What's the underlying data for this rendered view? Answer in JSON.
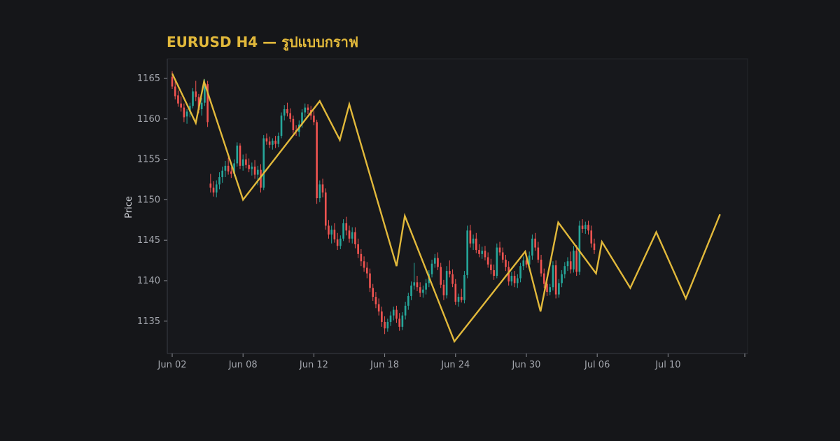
{
  "chart_data": {
    "type": "candlestick",
    "title": "EURUSD H4 — รูปแบบกราฟ",
    "ylabel": "Price",
    "ylim": [
      1131,
      1167
    ],
    "y_ticks": [
      1135,
      1140,
      1145,
      1150,
      1155,
      1160,
      1165
    ],
    "x_ticks": [
      "Jun 02",
      "Jun 08",
      "Jun 12",
      "Jun 18",
      "Jun 24",
      "Jun 30",
      "Jul 06",
      "Jul 10"
    ],
    "xlim": [
      0,
      48.5
    ],
    "x_tick_positions": [
      0,
      6,
      12,
      18,
      24,
      30,
      36,
      42
    ],
    "colors": {
      "background": "#151619",
      "plot_background": "#17181c",
      "up": "#26a69a",
      "down": "#ef5350",
      "zigzag": "#e2b93b",
      "axis": "#3a3d45",
      "text": "#a3a6ad"
    },
    "candle_step": 0.25,
    "candles": [
      [
        1165.2,
        1165.9,
        1163.7,
        1164.0
      ],
      [
        1164.0,
        1164.8,
        1162.4,
        1162.8
      ],
      [
        1162.9,
        1163.5,
        1161.5,
        1161.9
      ],
      [
        1161.9,
        1162.8,
        1160.9,
        1161.4
      ],
      [
        1161.4,
        1161.9,
        1159.6,
        1160.2
      ],
      [
        1160.3,
        1161.2,
        1159.4,
        1160.9
      ],
      [
        1160.9,
        1162.0,
        1160.2,
        1161.6
      ],
      [
        1161.6,
        1163.8,
        1161.3,
        1163.4
      ],
      [
        1163.4,
        1164.7,
        1162.2,
        1162.7
      ],
      [
        1162.7,
        1163.1,
        1160.7,
        1161.1
      ],
      [
        1161.2,
        1162.6,
        1160.4,
        1162.0
      ],
      [
        1162.0,
        1164.9,
        1161.6,
        1164.3
      ],
      [
        1164.3,
        1164.7,
        1159.0,
        1159.6
      ],
      [
        1152.0,
        1153.2,
        1150.9,
        1151.5
      ],
      [
        1151.5,
        1152.3,
        1150.4,
        1150.9
      ],
      [
        1150.9,
        1152.4,
        1150.3,
        1151.9
      ],
      [
        1151.9,
        1153.4,
        1151.3,
        1152.8
      ],
      [
        1152.8,
        1154.1,
        1152.1,
        1153.6
      ],
      [
        1153.6,
        1154.8,
        1152.8,
        1154.2
      ],
      [
        1154.2,
        1155.2,
        1153.1,
        1153.5
      ],
      [
        1153.5,
        1154.0,
        1152.7,
        1153.2
      ],
      [
        1153.2,
        1155.0,
        1152.9,
        1154.5
      ],
      [
        1154.5,
        1157.1,
        1154.1,
        1156.7
      ],
      [
        1156.7,
        1157.0,
        1153.8,
        1154.2
      ],
      [
        1154.2,
        1155.6,
        1153.6,
        1155.0
      ],
      [
        1155.0,
        1155.7,
        1153.9,
        1154.3
      ],
      [
        1154.3,
        1155.1,
        1153.4,
        1153.8
      ],
      [
        1153.8,
        1154.6,
        1153.0,
        1154.1
      ],
      [
        1154.1,
        1154.9,
        1152.6,
        1153.1
      ],
      [
        1153.1,
        1154.2,
        1151.8,
        1153.7
      ],
      [
        1153.7,
        1154.4,
        1150.9,
        1151.5
      ],
      [
        1151.5,
        1158.0,
        1151.2,
        1157.6
      ],
      [
        1157.6,
        1158.2,
        1156.8,
        1157.2
      ],
      [
        1157.2,
        1157.8,
        1156.4,
        1156.8
      ],
      [
        1156.8,
        1157.6,
        1156.2,
        1157.3
      ],
      [
        1157.3,
        1157.9,
        1156.4,
        1156.9
      ],
      [
        1156.9,
        1158.3,
        1156.5,
        1157.9
      ],
      [
        1157.9,
        1160.8,
        1157.6,
        1160.4
      ],
      [
        1160.4,
        1161.7,
        1159.8,
        1161.2
      ],
      [
        1161.2,
        1162.0,
        1160.3,
        1160.7
      ],
      [
        1160.7,
        1161.3,
        1159.6,
        1160.0
      ],
      [
        1160.0,
        1160.4,
        1158.2,
        1158.6
      ],
      [
        1158.6,
        1159.2,
        1157.9,
        1158.4
      ],
      [
        1158.4,
        1159.8,
        1157.8,
        1159.3
      ],
      [
        1159.3,
        1161.2,
        1158.9,
        1160.8
      ],
      [
        1160.8,
        1161.9,
        1160.2,
        1161.4
      ],
      [
        1161.4,
        1161.8,
        1160.6,
        1161.1
      ],
      [
        1161.1,
        1161.6,
        1159.9,
        1160.4
      ],
      [
        1160.4,
        1161.0,
        1159.2,
        1159.6
      ],
      [
        1159.6,
        1159.9,
        1149.5,
        1150.2
      ],
      [
        1150.2,
        1152.4,
        1149.7,
        1151.9
      ],
      [
        1151.9,
        1152.6,
        1150.3,
        1150.9
      ],
      [
        1150.9,
        1151.4,
        1146.3,
        1146.8
      ],
      [
        1146.8,
        1147.5,
        1145.2,
        1145.7
      ],
      [
        1145.7,
        1146.8,
        1144.6,
        1146.3
      ],
      [
        1146.3,
        1147.1,
        1144.7,
        1145.1
      ],
      [
        1145.1,
        1145.9,
        1143.8,
        1144.3
      ],
      [
        1144.3,
        1145.6,
        1143.9,
        1145.2
      ],
      [
        1145.2,
        1147.6,
        1144.9,
        1147.1
      ],
      [
        1147.1,
        1147.9,
        1145.6,
        1146.2
      ],
      [
        1146.2,
        1146.8,
        1144.7,
        1145.2
      ],
      [
        1145.2,
        1146.6,
        1144.6,
        1146.0
      ],
      [
        1146.0,
        1146.6,
        1144.0,
        1144.5
      ],
      [
        1144.5,
        1145.2,
        1142.8,
        1143.3
      ],
      [
        1143.3,
        1143.9,
        1141.8,
        1142.4
      ],
      [
        1142.4,
        1143.0,
        1141.1,
        1141.6
      ],
      [
        1141.6,
        1142.3,
        1140.3,
        1140.9
      ],
      [
        1140.9,
        1141.5,
        1138.6,
        1139.1
      ],
      [
        1139.1,
        1139.6,
        1137.5,
        1138.0
      ],
      [
        1138.0,
        1138.6,
        1136.6,
        1137.1
      ],
      [
        1137.1,
        1137.8,
        1135.7,
        1136.2
      ],
      [
        1136.2,
        1136.8,
        1134.3,
        1134.9
      ],
      [
        1134.9,
        1135.6,
        1133.4,
        1134.1
      ],
      [
        1134.1,
        1135.3,
        1133.7,
        1134.9
      ],
      [
        1134.9,
        1136.2,
        1134.4,
        1135.7
      ],
      [
        1135.7,
        1136.8,
        1135.1,
        1136.4
      ],
      [
        1136.4,
        1136.9,
        1134.8,
        1135.3
      ],
      [
        1135.3,
        1136.0,
        1133.8,
        1134.3
      ],
      [
        1134.3,
        1136.1,
        1133.9,
        1135.7
      ],
      [
        1135.7,
        1137.4,
        1135.2,
        1136.9
      ],
      [
        1136.9,
        1138.5,
        1136.4,
        1138.1
      ],
      [
        1138.1,
        1139.9,
        1137.6,
        1139.4
      ],
      [
        1139.4,
        1142.2,
        1138.9,
        1139.8
      ],
      [
        1139.8,
        1140.6,
        1138.7,
        1139.2
      ],
      [
        1139.2,
        1139.8,
        1138.0,
        1138.5
      ],
      [
        1138.5,
        1139.4,
        1137.9,
        1138.9
      ],
      [
        1138.9,
        1140.2,
        1138.3,
        1139.7
      ],
      [
        1139.7,
        1141.3,
        1139.2,
        1140.8
      ],
      [
        1140.8,
        1142.6,
        1140.4,
        1142.1
      ],
      [
        1142.1,
        1143.3,
        1141.6,
        1142.8
      ],
      [
        1142.8,
        1143.5,
        1141.3,
        1141.7
      ],
      [
        1141.7,
        1142.2,
        1139.1,
        1139.5
      ],
      [
        1139.5,
        1140.1,
        1137.6,
        1138.2
      ],
      [
        1138.2,
        1141.8,
        1137.8,
        1141.2
      ],
      [
        1141.2,
        1142.5,
        1140.4,
        1140.8
      ],
      [
        1140.8,
        1141.4,
        1139.2,
        1139.6
      ],
      [
        1139.6,
        1140.2,
        1137.0,
        1137.4
      ],
      [
        1137.4,
        1138.4,
        1136.8,
        1138.0
      ],
      [
        1138.0,
        1139.0,
        1137.3,
        1137.6
      ],
      [
        1137.6,
        1141.2,
        1137.2,
        1140.7
      ],
      [
        1140.7,
        1146.8,
        1140.3,
        1146.2
      ],
      [
        1146.2,
        1146.9,
        1144.1,
        1144.6
      ],
      [
        1144.6,
        1145.7,
        1143.8,
        1145.2
      ],
      [
        1145.2,
        1145.9,
        1143.4,
        1143.8
      ],
      [
        1143.8,
        1144.5,
        1142.9,
        1143.3
      ],
      [
        1143.3,
        1144.2,
        1142.7,
        1143.7
      ],
      [
        1143.7,
        1144.3,
        1142.5,
        1142.9
      ],
      [
        1142.9,
        1143.5,
        1141.6,
        1142.0
      ],
      [
        1142.0,
        1142.7,
        1140.8,
        1141.3
      ],
      [
        1141.3,
        1142.0,
        1140.1,
        1140.6
      ],
      [
        1140.6,
        1144.6,
        1140.3,
        1144.1
      ],
      [
        1144.1,
        1144.8,
        1143.1,
        1143.5
      ],
      [
        1143.5,
        1144.1,
        1142.2,
        1142.6
      ],
      [
        1142.6,
        1143.2,
        1141.2,
        1141.7
      ],
      [
        1141.7,
        1142.4,
        1139.4,
        1139.9
      ],
      [
        1139.9,
        1141.1,
        1139.4,
        1140.6
      ],
      [
        1140.6,
        1141.2,
        1139.2,
        1139.7
      ],
      [
        1139.7,
        1140.8,
        1139.1,
        1140.3
      ],
      [
        1140.3,
        1142.2,
        1139.8,
        1141.8
      ],
      [
        1141.8,
        1143.0,
        1141.3,
        1142.5
      ],
      [
        1142.5,
        1143.4,
        1141.6,
        1142.0
      ],
      [
        1142.0,
        1143.6,
        1141.5,
        1143.1
      ],
      [
        1143.1,
        1145.7,
        1142.6,
        1145.2
      ],
      [
        1145.2,
        1145.9,
        1143.7,
        1144.1
      ],
      [
        1144.1,
        1144.8,
        1142.2,
        1142.6
      ],
      [
        1142.6,
        1143.2,
        1140.5,
        1140.9
      ],
      [
        1140.9,
        1141.5,
        1139.1,
        1139.6
      ],
      [
        1139.6,
        1140.3,
        1138.1,
        1138.6
      ],
      [
        1138.6,
        1139.6,
        1138.2,
        1139.2
      ],
      [
        1139.2,
        1142.4,
        1138.8,
        1141.9
      ],
      [
        1141.9,
        1142.5,
        1137.8,
        1138.3
      ],
      [
        1138.3,
        1140.2,
        1137.9,
        1139.7
      ],
      [
        1139.7,
        1141.3,
        1139.2,
        1140.8
      ],
      [
        1140.8,
        1142.3,
        1140.3,
        1141.8
      ],
      [
        1141.8,
        1142.9,
        1141.2,
        1142.4
      ],
      [
        1142.4,
        1143.6,
        1140.9,
        1141.4
      ],
      [
        1141.4,
        1144.3,
        1141.0,
        1143.7
      ],
      [
        1143.7,
        1144.4,
        1140.6,
        1141.1
      ],
      [
        1141.1,
        1147.4,
        1140.7,
        1146.8
      ],
      [
        1146.8,
        1147.6,
        1145.9,
        1146.4
      ],
      [
        1146.4,
        1147.3,
        1145.8,
        1146.9
      ],
      [
        1146.9,
        1147.4,
        1145.7,
        1146.2
      ],
      [
        1146.2,
        1146.8,
        1144.1,
        1144.6
      ],
      [
        1144.6,
        1145.2,
        1143.3,
        1143.8
      ]
    ],
    "zigzag": [
      [
        0,
        1165.6
      ],
      [
        2,
        1159.5
      ],
      [
        2.7,
        1164.6
      ],
      [
        6,
        1150.0
      ],
      [
        12.5,
        1162.2
      ],
      [
        14.2,
        1157.4
      ],
      [
        15,
        1161.8
      ],
      [
        19,
        1141.8
      ],
      [
        19.7,
        1148.0
      ],
      [
        23.9,
        1132.5
      ],
      [
        29.9,
        1143.6
      ],
      [
        31.2,
        1136.2
      ],
      [
        32.7,
        1147.2
      ],
      [
        35.9,
        1140.9
      ],
      [
        36.4,
        1144.8
      ],
      [
        38.8,
        1139.1
      ],
      [
        41,
        1146.0
      ],
      [
        43.5,
        1137.8
      ],
      [
        46.4,
        1148.2
      ]
    ]
  }
}
